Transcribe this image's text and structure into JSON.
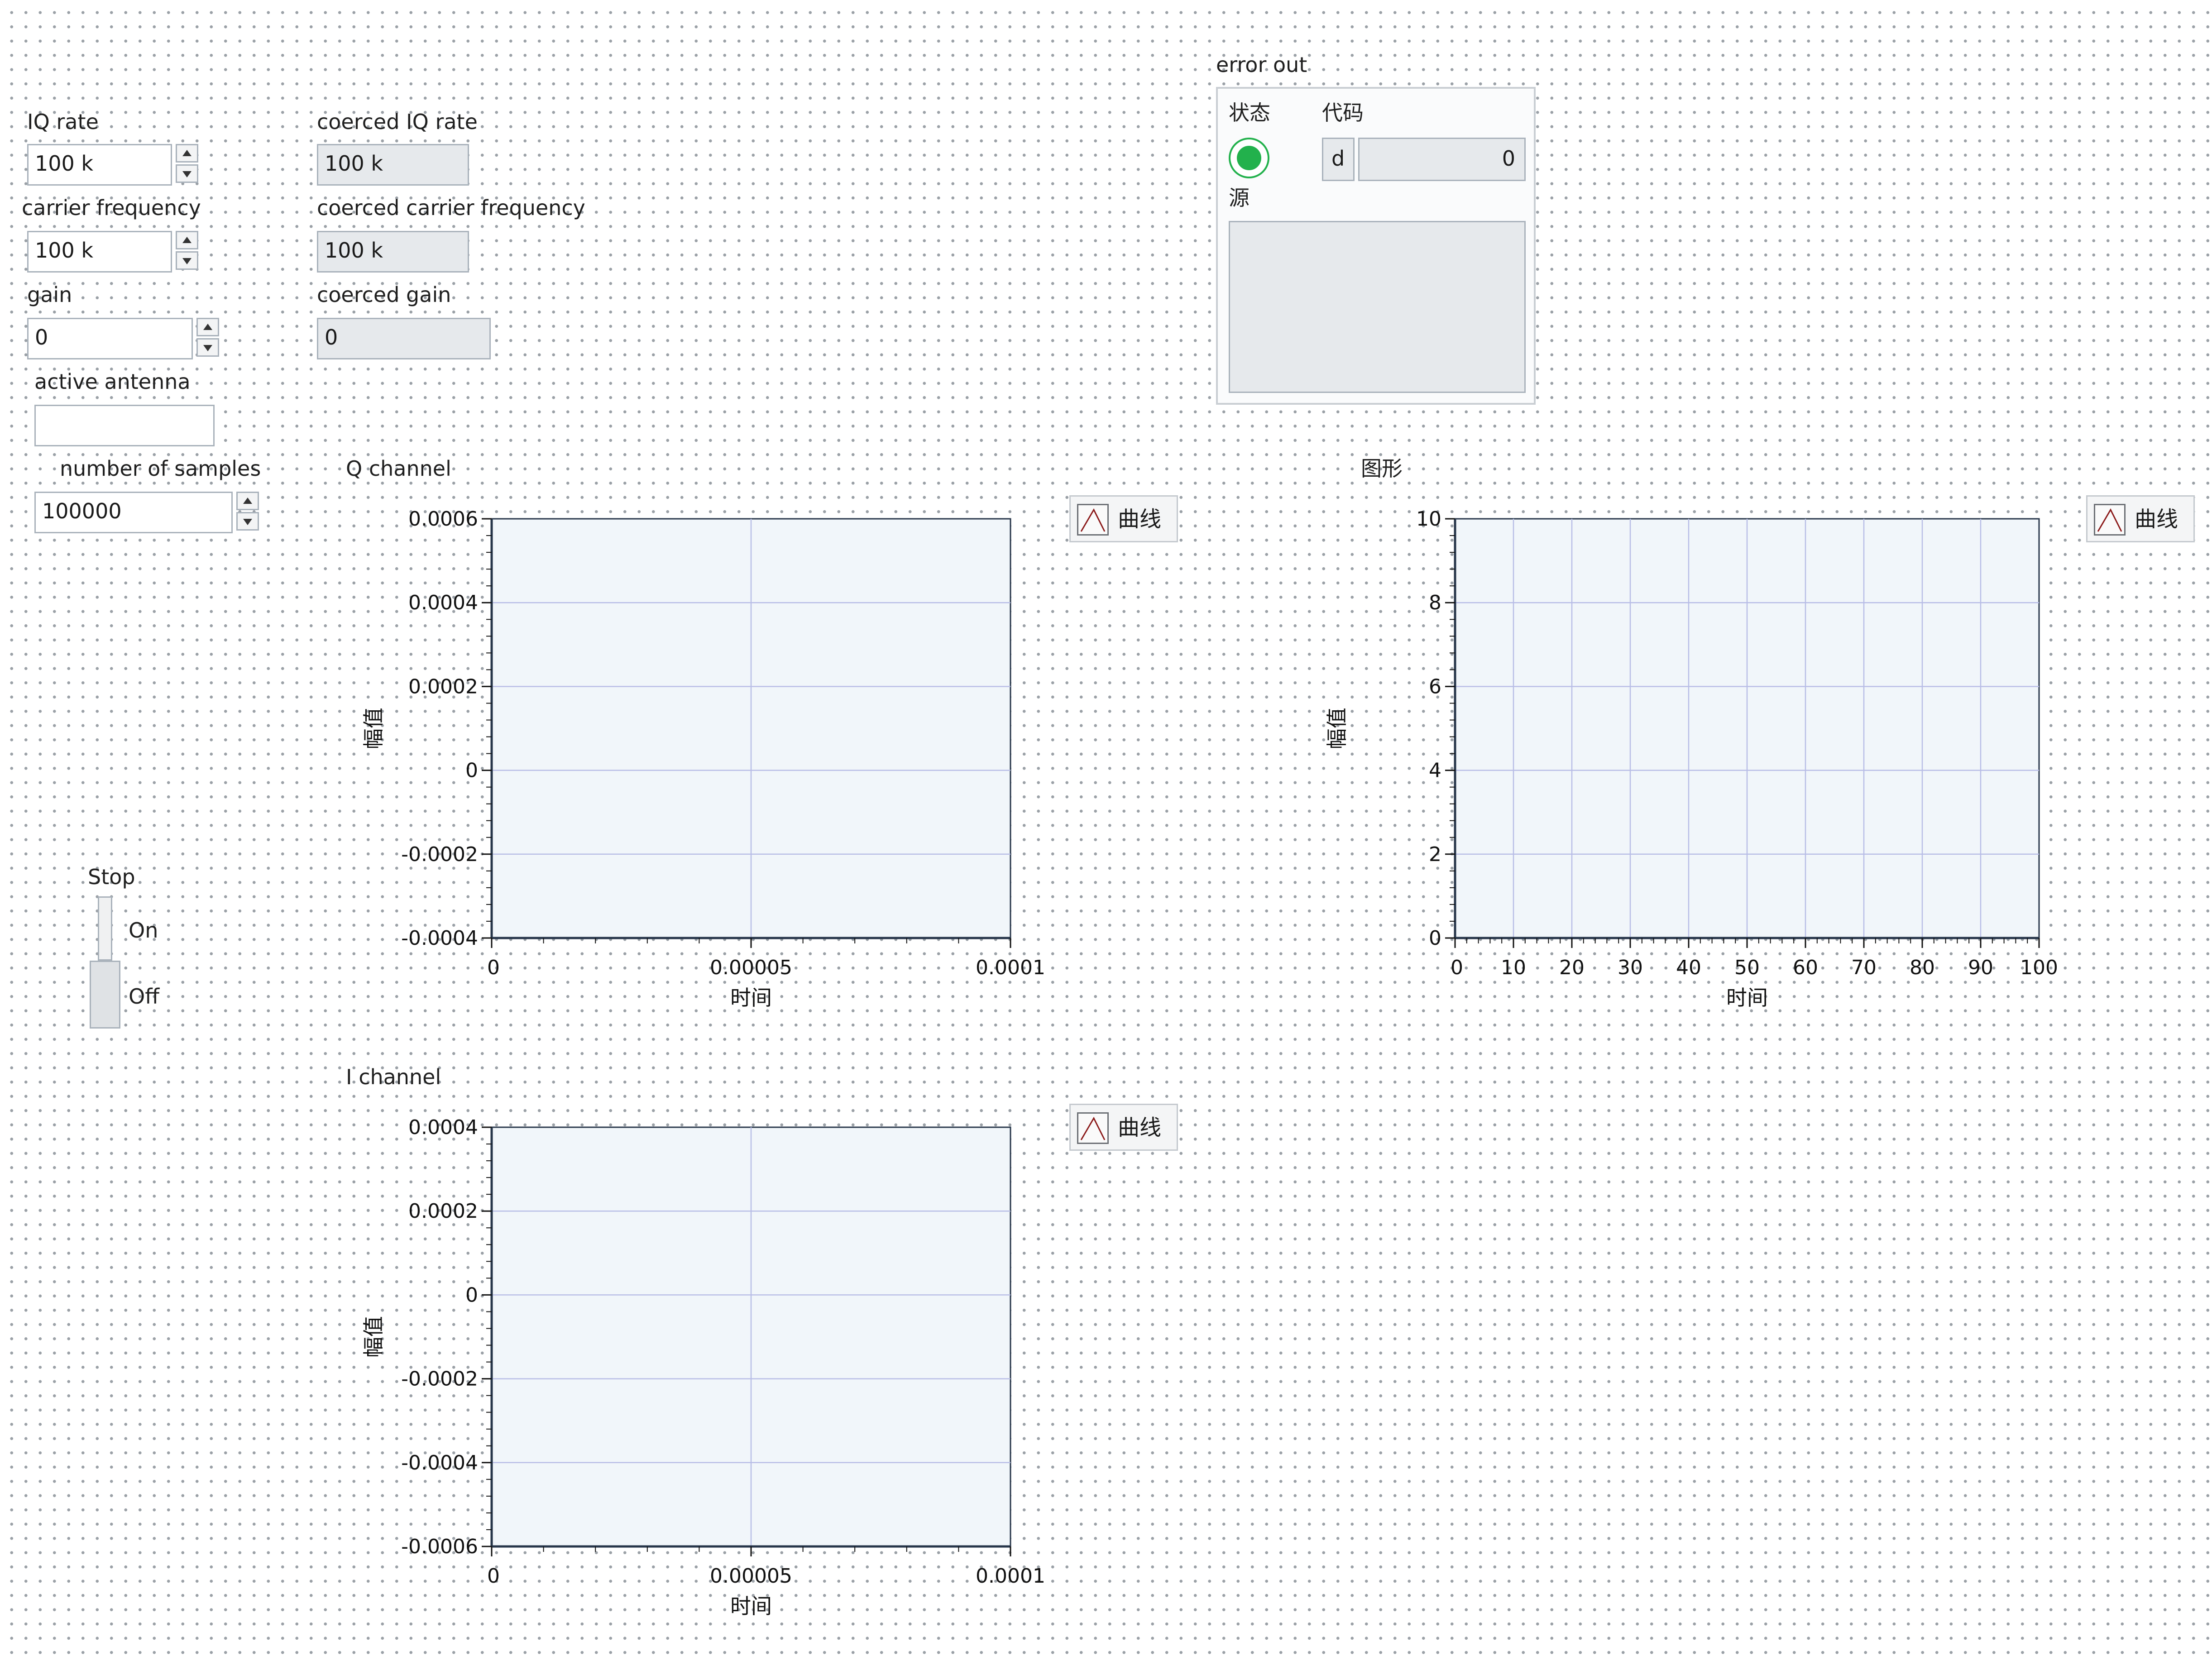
{
  "controls": {
    "iq_rate": {
      "label": "IQ rate",
      "value": "100 k"
    },
    "carrier_frequency": {
      "label": "carrier frequency",
      "value": "100 k"
    },
    "gain": {
      "label": "gain",
      "value": "0"
    },
    "active_antenna": {
      "label": "active antenna",
      "value": ""
    },
    "number_of_samples": {
      "label": "number of samples",
      "value": "100000"
    }
  },
  "indicators": {
    "coerced_iq_rate": {
      "label": "coerced IQ rate",
      "value": "100 k"
    },
    "coerced_carrier_frequency": {
      "label": "coerced carrier frequency",
      "value": "100 k"
    },
    "coerced_gain": {
      "label": "coerced gain",
      "value": "0"
    }
  },
  "error_out": {
    "title": "error out",
    "status_label": "状态",
    "code_label": "代码",
    "code_prefix": "d",
    "code_value": "0",
    "source_label": "源",
    "source_value": "",
    "status_color": "#22b14c"
  },
  "stop": {
    "label": "Stop",
    "on_label": "On",
    "off_label": "Off",
    "state": "Off"
  },
  "colors": {
    "plot_bg": "#f1f6fa",
    "grid": "#b8bde6",
    "axis": "#27364a",
    "legend_line": "#8b1a1a"
  },
  "chart_data": [
    {
      "id": "q_channel",
      "type": "line",
      "title": "Q channel",
      "xlabel": "时间",
      "ylabel": "幅值",
      "legend": [
        "曲线"
      ],
      "legend_label": "曲线",
      "xlim": [
        0,
        0.0001
      ],
      "ylim": [
        -0.0004,
        0.0006
      ],
      "x_ticks": [
        0,
        5e-05,
        0.0001
      ],
      "x_tick_labels": [
        "0",
        "0.00005",
        "0.0001"
      ],
      "y_ticks": [
        -0.0004,
        -0.0002,
        0,
        0.0002,
        0.0004,
        0.0006
      ],
      "y_tick_labels": [
        "-0.0004",
        "-0.0002",
        "0",
        "0.0002",
        "0.0004",
        "0.0006"
      ],
      "series": [
        {
          "values": []
        }
      ],
      "grid": true
    },
    {
      "id": "graph",
      "type": "line",
      "title": "图形",
      "xlabel": "时间",
      "ylabel": "幅值",
      "legend": [
        "曲线"
      ],
      "legend_label": "曲线",
      "xlim": [
        0,
        100
      ],
      "ylim": [
        0,
        10
      ],
      "x_ticks": [
        0,
        10,
        20,
        30,
        40,
        50,
        60,
        70,
        80,
        90,
        100
      ],
      "x_tick_labels": [
        "0",
        "10",
        "20",
        "30",
        "40",
        "50",
        "60",
        "70",
        "80",
        "90",
        "100"
      ],
      "y_ticks": [
        0,
        2,
        4,
        6,
        8,
        10
      ],
      "y_tick_labels": [
        "0",
        "2",
        "4",
        "6",
        "8",
        "10"
      ],
      "series": [
        {
          "values": []
        }
      ],
      "grid": true
    },
    {
      "id": "i_channel",
      "type": "line",
      "title": "I channel",
      "xlabel": "时间",
      "ylabel": "幅值",
      "legend": [
        "曲线"
      ],
      "legend_label": "曲线",
      "xlim": [
        0,
        0.0001
      ],
      "ylim": [
        -0.0006,
        0.0004
      ],
      "x_ticks": [
        0,
        5e-05,
        0.0001
      ],
      "x_tick_labels": [
        "0",
        "0.00005",
        "0.0001"
      ],
      "y_ticks": [
        -0.0006,
        -0.0004,
        -0.0002,
        0,
        0.0002,
        0.0004
      ],
      "y_tick_labels": [
        "-0.0006",
        "-0.0004",
        "-0.0002",
        "0",
        "0.0002",
        "0.0004"
      ],
      "series": [
        {
          "values": []
        }
      ],
      "grid": true
    }
  ]
}
